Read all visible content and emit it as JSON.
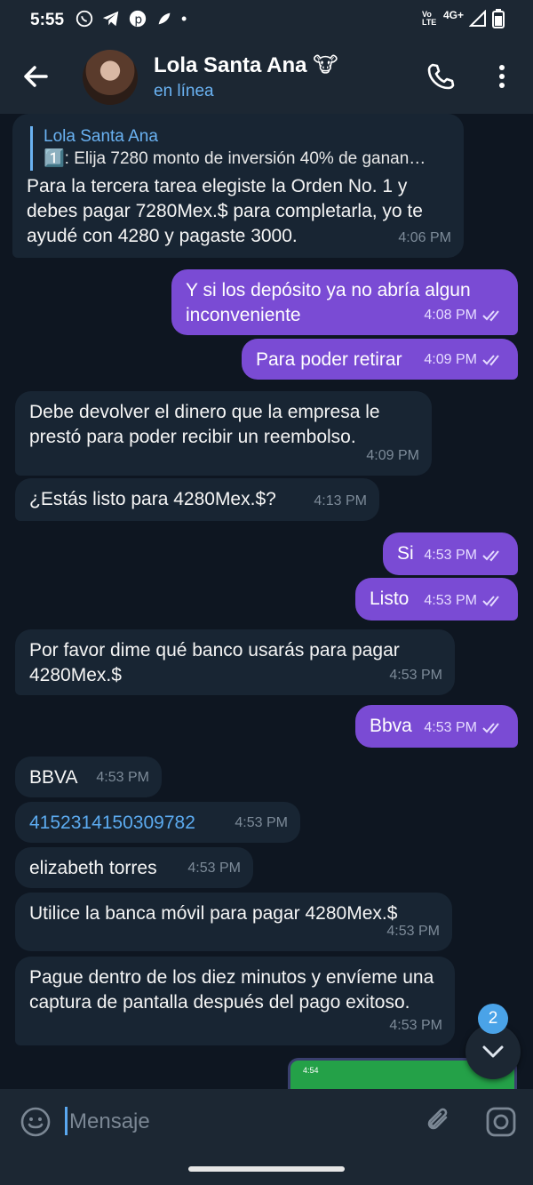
{
  "status_bar": {
    "time": "5:55",
    "network": "4G+",
    "carrier_badge": "Vo LTE",
    "dot": "•"
  },
  "header": {
    "title": "Lola Santa Ana",
    "title_emoji": "🐮",
    "status": "en línea"
  },
  "messages": [
    {
      "dir": "in",
      "reply_name": "Lola Santa Ana",
      "reply_text": "1️⃣: Elija 7280  monto de inversión 40% de ganan…",
      "text": "Para la tercera tarea elegiste la Orden No. 1 y debes pagar 7280Mex.$ para completarla, yo te ayudé con 4280 y pagaste 3000.",
      "time": "4:06 PM"
    },
    {
      "dir": "out",
      "text": "Y si los depósito ya no abría algun inconveniente",
      "time": "4:08 PM"
    },
    {
      "dir": "out",
      "text": "Para poder retirar",
      "time": "4:09 PM"
    },
    {
      "dir": "in",
      "text": "Debe devolver el dinero que la empresa le prestó para poder recibir un reembolso.",
      "time": "4:09 PM"
    },
    {
      "dir": "in",
      "text": "¿Estás listo para 4280Mex.$?",
      "time": "4:13 PM"
    },
    {
      "dir": "out",
      "text": "Si",
      "time": "4:53 PM"
    },
    {
      "dir": "out",
      "text": "Listo",
      "time": "4:53 PM"
    },
    {
      "dir": "in",
      "text": "Por favor dime qué banco usarás para pagar 4280Mex.$",
      "time": "4:53 PM"
    },
    {
      "dir": "out",
      "text": "Bbva",
      "time": "4:53 PM"
    },
    {
      "dir": "in",
      "text": "BBVA",
      "time": "4:53 PM"
    },
    {
      "dir": "in",
      "text": "4152314150309782",
      "time": "4:53 PM"
    },
    {
      "dir": "in",
      "text": "elizabeth torres",
      "time": "4:53 PM"
    },
    {
      "dir": "in",
      "text": "Utilice la banca móvil para pagar 4280Mex.$",
      "time": "4:53 PM"
    },
    {
      "dir": "in",
      "text": "Pague dentro de los diez minutos y envíeme una captura de pantalla después del pago exitoso.",
      "time": "4:53 PM"
    }
  ],
  "media_preview": {
    "time": "4:54"
  },
  "scroll_badge": "2",
  "input": {
    "placeholder": "Mensaje"
  },
  "colors": {
    "background": "#0e1621",
    "bar": "#1c2733",
    "incoming": "#182533",
    "outgoing": "#7a4bd4",
    "accent": "#6ab2f2"
  },
  "icons": [
    "back-arrow-icon",
    "phone-icon",
    "more-vert-icon",
    "emoji-icon",
    "paperclip-icon",
    "camera-icon",
    "chevron-down-icon",
    "double-check-icon"
  ]
}
